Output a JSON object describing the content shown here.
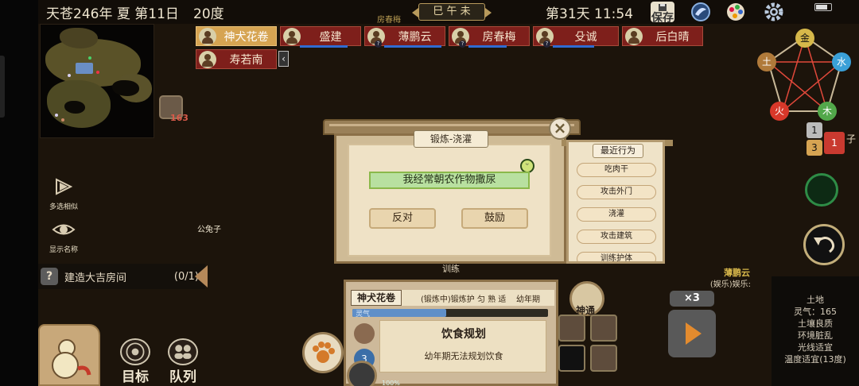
{
  "topbar": {
    "date": "天苍246年 夏 第11日",
    "temperature": "20度",
    "ganzhi": "巳 午 未",
    "floating_name": "房春梅",
    "day_time": "第31天 11:54",
    "save_label": "保存"
  },
  "characters": [
    {
      "name": "神犬花卷"
    },
    {
      "name": "盛建"
    },
    {
      "name": "薄鹏云"
    },
    {
      "name": "房春梅"
    },
    {
      "name": "殳诚"
    },
    {
      "name": "后白晴"
    },
    {
      "name": "寿若南"
    }
  ],
  "map": {
    "bag_count": "163"
  },
  "left_tools": {
    "multi_select": "多选相似",
    "show_names": "显示名称"
  },
  "npc_label": "公兔子",
  "task": {
    "label": "建造大吉房间",
    "count": "(0/1)"
  },
  "bottom_buttons": {
    "target": "目标",
    "queue": "队列"
  },
  "dialog": {
    "title": "锻炼-浇灌",
    "speech": "我经常朝农作物撒尿",
    "oppose": "反对",
    "encourage": "鼓励"
  },
  "recent": {
    "title": "最近行为",
    "items": [
      "吃肉干",
      "攻击外门",
      "浇灌",
      "攻击建筑",
      "训练护体"
    ]
  },
  "training_label": "训练",
  "char_panel": {
    "name": "神犬花卷",
    "status": "(锻炼中)锻炼护",
    "status_tags": [
      "匀",
      "熟",
      "适"
    ],
    "age": "幼年期",
    "lingqi_label": "灵气",
    "lingqi_fraction": 0.48,
    "box_title": "饮食规划",
    "box_desc": "幼年期无法规划饮食",
    "percent": "100%",
    "badge": "3"
  },
  "shentong_label": "神通",
  "speed_label": "×3",
  "selected": {
    "name": "薄鹏云",
    "activity": "(娱乐)娱乐:"
  },
  "tile_info": [
    "土地",
    "灵气：165",
    "土壤良质",
    "环境脏乱",
    "光线适宜",
    "温度适宜(13度)"
  ],
  "wuxing": [
    "金",
    "水",
    "木",
    "火",
    "土"
  ],
  "right_numbers": {
    "a": "1",
    "b": "3",
    "c": "1",
    "side": "子"
  }
}
